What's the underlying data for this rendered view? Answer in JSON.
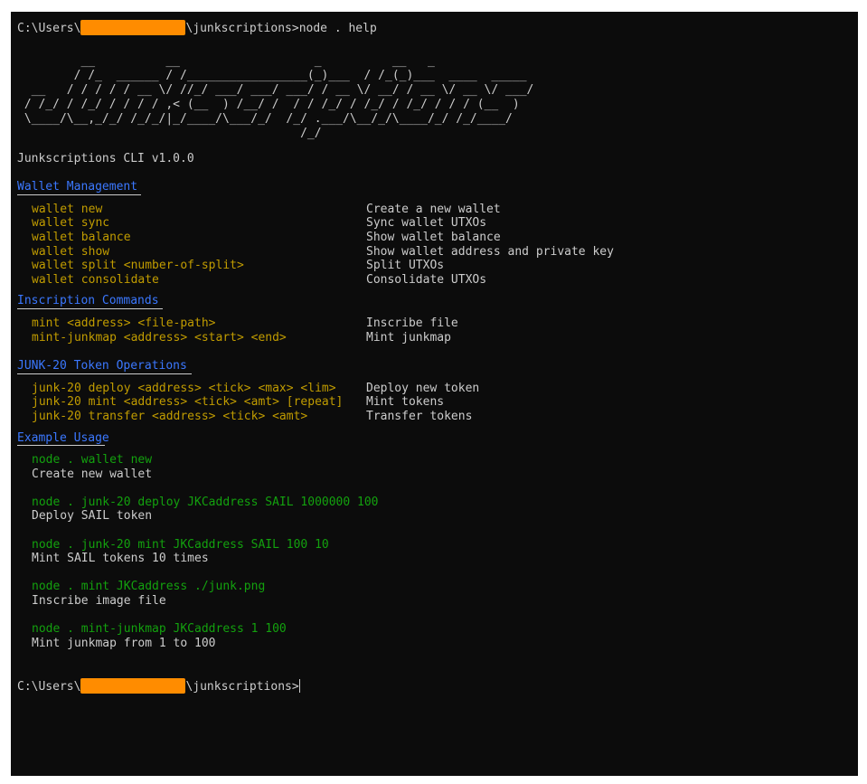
{
  "prompt": {
    "prefix": "C:\\Users\\",
    "suffix": "\\junkscriptions>",
    "command": "node . help"
  },
  "ascii_art": [
    "         __          __                   _          __   _",
    "        / /_  ______ / /_________________(_)___  / /_(_)___  ____  _____",
    "  __   / / / / / __ \\/ //_/ ___/ ___/ ___/ / __ \\/ __/ / __ \\/ __ \\/ ___/",
    " / /_/ / /_/ / / / / ,< (__  ) /__/ /  / / /_/ / /_/ / /_/ / / / (__  )",
    " \\____/\\__,_/_/ /_/_/|_/____/\\___/_/  /_/ .___/\\__/_/\\____/_/ /_/____/",
    "                                        /_/"
  ],
  "version": "Junkscriptions CLI v1.0.0",
  "sections": {
    "wallet": {
      "title": "Wallet Management",
      "rows": [
        {
          "cmd": "wallet new",
          "desc": "Create a new wallet"
        },
        {
          "cmd": "wallet sync",
          "desc": "Sync wallet UTXOs"
        },
        {
          "cmd": "wallet balance",
          "desc": "Show wallet balance"
        },
        {
          "cmd": "wallet show",
          "desc": "Show wallet address and private key"
        },
        {
          "cmd": "wallet split <number-of-split>",
          "desc": "Split UTXOs"
        },
        {
          "cmd": "wallet consolidate",
          "desc": "Consolidate UTXOs"
        }
      ]
    },
    "inscription": {
      "title": "Inscription Commands",
      "rows": [
        {
          "cmd": "mint <address> <file-path>",
          "desc": "Inscribe file"
        },
        {
          "cmd": "mint-junkmap <address> <start> <end>",
          "desc": "Mint junkmap"
        }
      ]
    },
    "junk20": {
      "title": "JUNK-20 Token Operations",
      "rows": [
        {
          "cmd": "junk-20 deploy <address> <tick> <max> <lim>",
          "desc": "Deploy new token"
        },
        {
          "cmd": "junk-20 mint <address> <tick> <amt> [repeat]",
          "desc": "Mint tokens"
        },
        {
          "cmd": "junk-20 transfer <address> <tick> <amt>",
          "desc": "Transfer tokens"
        }
      ]
    },
    "examples": {
      "title": "Example Usage",
      "items": [
        {
          "cmd": "node . wallet new",
          "desc": "Create new wallet"
        },
        {
          "cmd": "node . junk-20 deploy JKCaddress SAIL 1000000 100",
          "desc": "Deploy SAIL token"
        },
        {
          "cmd": "node . junk-20 mint JKCaddress SAIL 100 10",
          "desc": "Mint SAIL tokens 10 times"
        },
        {
          "cmd": "node . mint JKCaddress ./junk.png",
          "desc": "Inscribe image file"
        },
        {
          "cmd": "node . mint-junkmap JKCaddress 1 100",
          "desc": "Mint junkmap from 1 to 100"
        }
      ]
    }
  },
  "colors": {
    "background": "#0c0c0c",
    "foreground": "#cccccc",
    "section_title": "#3b78ff",
    "command": "#c19c00",
    "example": "#13a10e",
    "redaction": "#ff8c00"
  }
}
